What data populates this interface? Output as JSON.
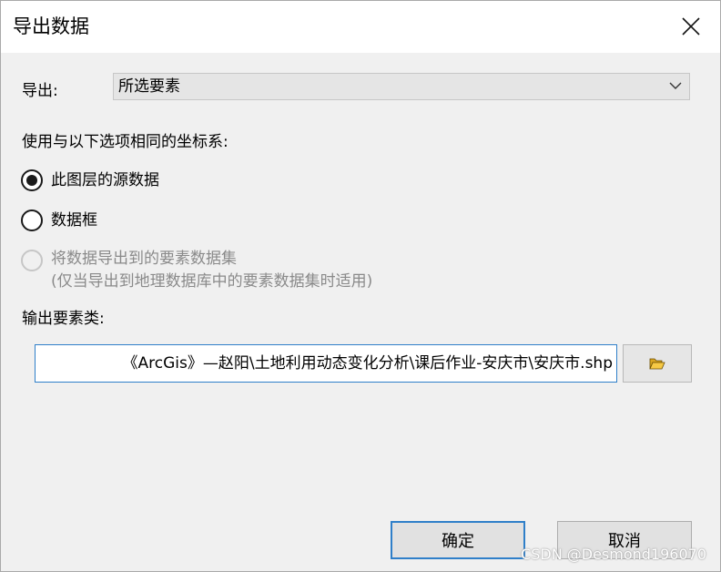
{
  "dialog": {
    "title": "导出数据"
  },
  "export": {
    "label": "导出:",
    "selected": "所选要素"
  },
  "coordinate": {
    "label": "使用与以下选项相同的坐标系:",
    "options": [
      {
        "label": "此图层的源数据",
        "checked": true,
        "enabled": true
      },
      {
        "label": "数据框",
        "checked": false,
        "enabled": true
      },
      {
        "label": "将数据导出到的要素数据集",
        "sublabel": "(仅当导出到地理数据库中的要素数据集时适用)",
        "checked": false,
        "enabled": false
      }
    ]
  },
  "output": {
    "label": "输出要素类:",
    "value": "《ArcGis》—赵阳\\土地利用动态变化分析\\课后作业-安庆市\\安庆市.shp"
  },
  "buttons": {
    "ok": "确定",
    "cancel": "取消"
  },
  "watermark": "CSDN @Desmond196070",
  "icons": {
    "close": "close-icon",
    "dropdown": "chevron-down-icon",
    "browse": "open-folder-icon"
  },
  "colors": {
    "accent": "#2f7fc9",
    "background": "#f0f0f0"
  }
}
